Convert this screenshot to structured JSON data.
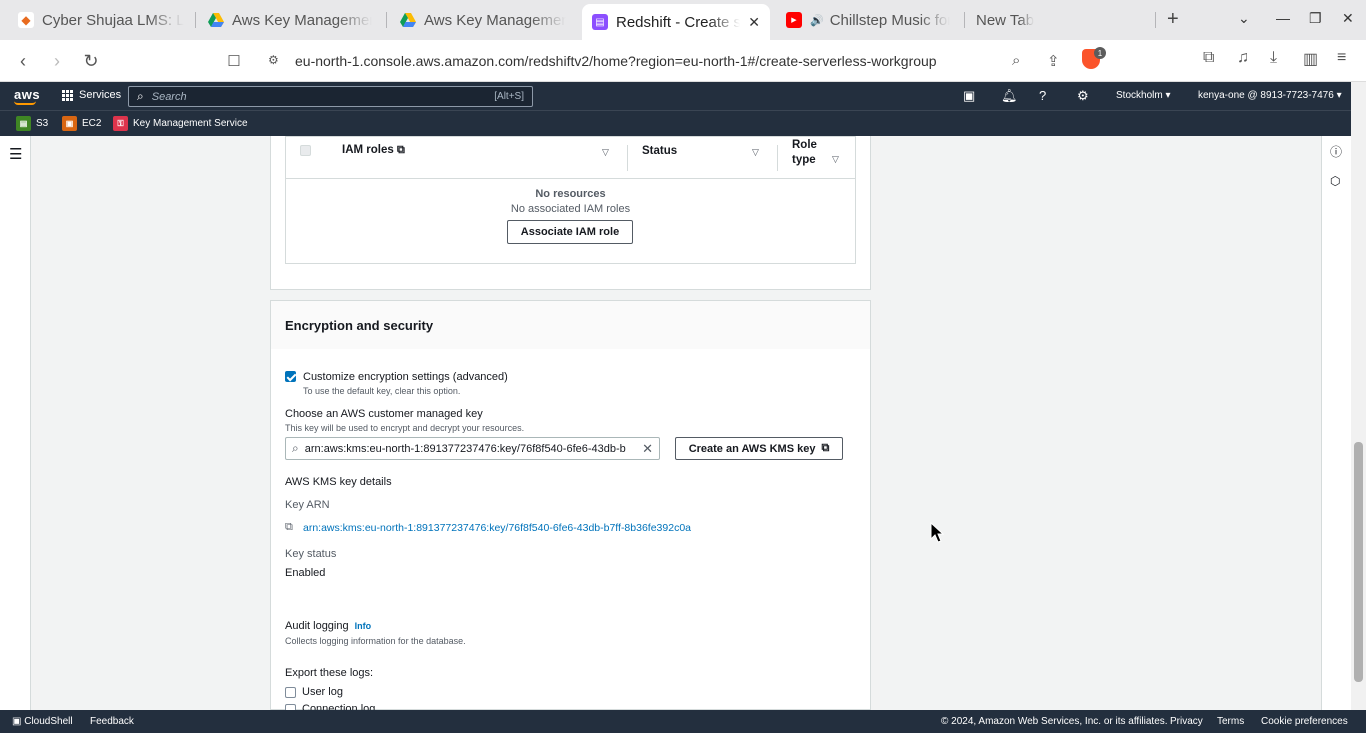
{
  "browser": {
    "tabs": [
      {
        "title": "Cyber Shujaa LMS: Lo",
        "favicon": "cyber-shujaa-icon"
      },
      {
        "title": "Aws Key Management",
        "favicon": "google-drive-icon"
      },
      {
        "title": "Aws Key Management",
        "favicon": "google-drive-icon"
      },
      {
        "title": "Redshift - Create s",
        "favicon": "redshift-icon",
        "active": true
      },
      {
        "title": "Chillstep Music for",
        "favicon": "youtube-icon"
      },
      {
        "title": "New Tab",
        "favicon": ""
      }
    ],
    "url": "eu-north-1.console.aws.amazon.com/redshiftv2/home?region=eu-north-1#/create-serverless-workgroup",
    "brave_badge": "1"
  },
  "aws_header": {
    "logo": "aws",
    "services_label": "Services",
    "search_placeholder": "Search",
    "search_shortcut": "[Alt+S]",
    "region": "Stockholm",
    "account": "kenya-one @ 8913-7723-7476",
    "favorites": [
      {
        "label": "S3",
        "color": "#3f8624"
      },
      {
        "label": "EC2",
        "color": "#d86613"
      },
      {
        "label": "Key Management Service",
        "color": "#dd344c"
      }
    ]
  },
  "iam_table": {
    "columns": [
      "IAM roles",
      "Status",
      "Role type"
    ],
    "empty_title": "No resources",
    "empty_desc": "No associated IAM roles",
    "associate_button": "Associate IAM role"
  },
  "encryption": {
    "title": "Encryption and security",
    "customize_label": "Customize encryption settings (advanced)",
    "customize_checked": true,
    "customize_desc": "To use the default key, clear this option.",
    "choose_key_label": "Choose an AWS customer managed key",
    "choose_key_desc": "This key will be used to encrypt and decrypt your resources.",
    "key_input_value": "arn:aws:kms:eu-north-1:891377237476:key/76f8f540-6fe6-43db-b",
    "create_key_button": "Create an AWS KMS key",
    "details_title": "AWS KMS key details",
    "key_arn_label": "Key ARN",
    "key_arn_value": "arn:aws:kms:eu-north-1:891377237476:key/76f8f540-6fe6-43db-b7ff-8b36fe392c0a",
    "key_status_label": "Key status",
    "key_status_value": "Enabled"
  },
  "audit": {
    "title": "Audit logging",
    "info": "Info",
    "desc": "Collects logging information for the database.",
    "export_label": "Export these logs:",
    "logs": [
      "User log",
      "Connection log"
    ]
  },
  "footer": {
    "cloudshell": "CloudShell",
    "feedback": "Feedback",
    "copyright": "© 2024, Amazon Web Services, Inc. or its affiliates.",
    "privacy": "Privacy",
    "terms": "Terms",
    "cookies": "Cookie preferences"
  }
}
